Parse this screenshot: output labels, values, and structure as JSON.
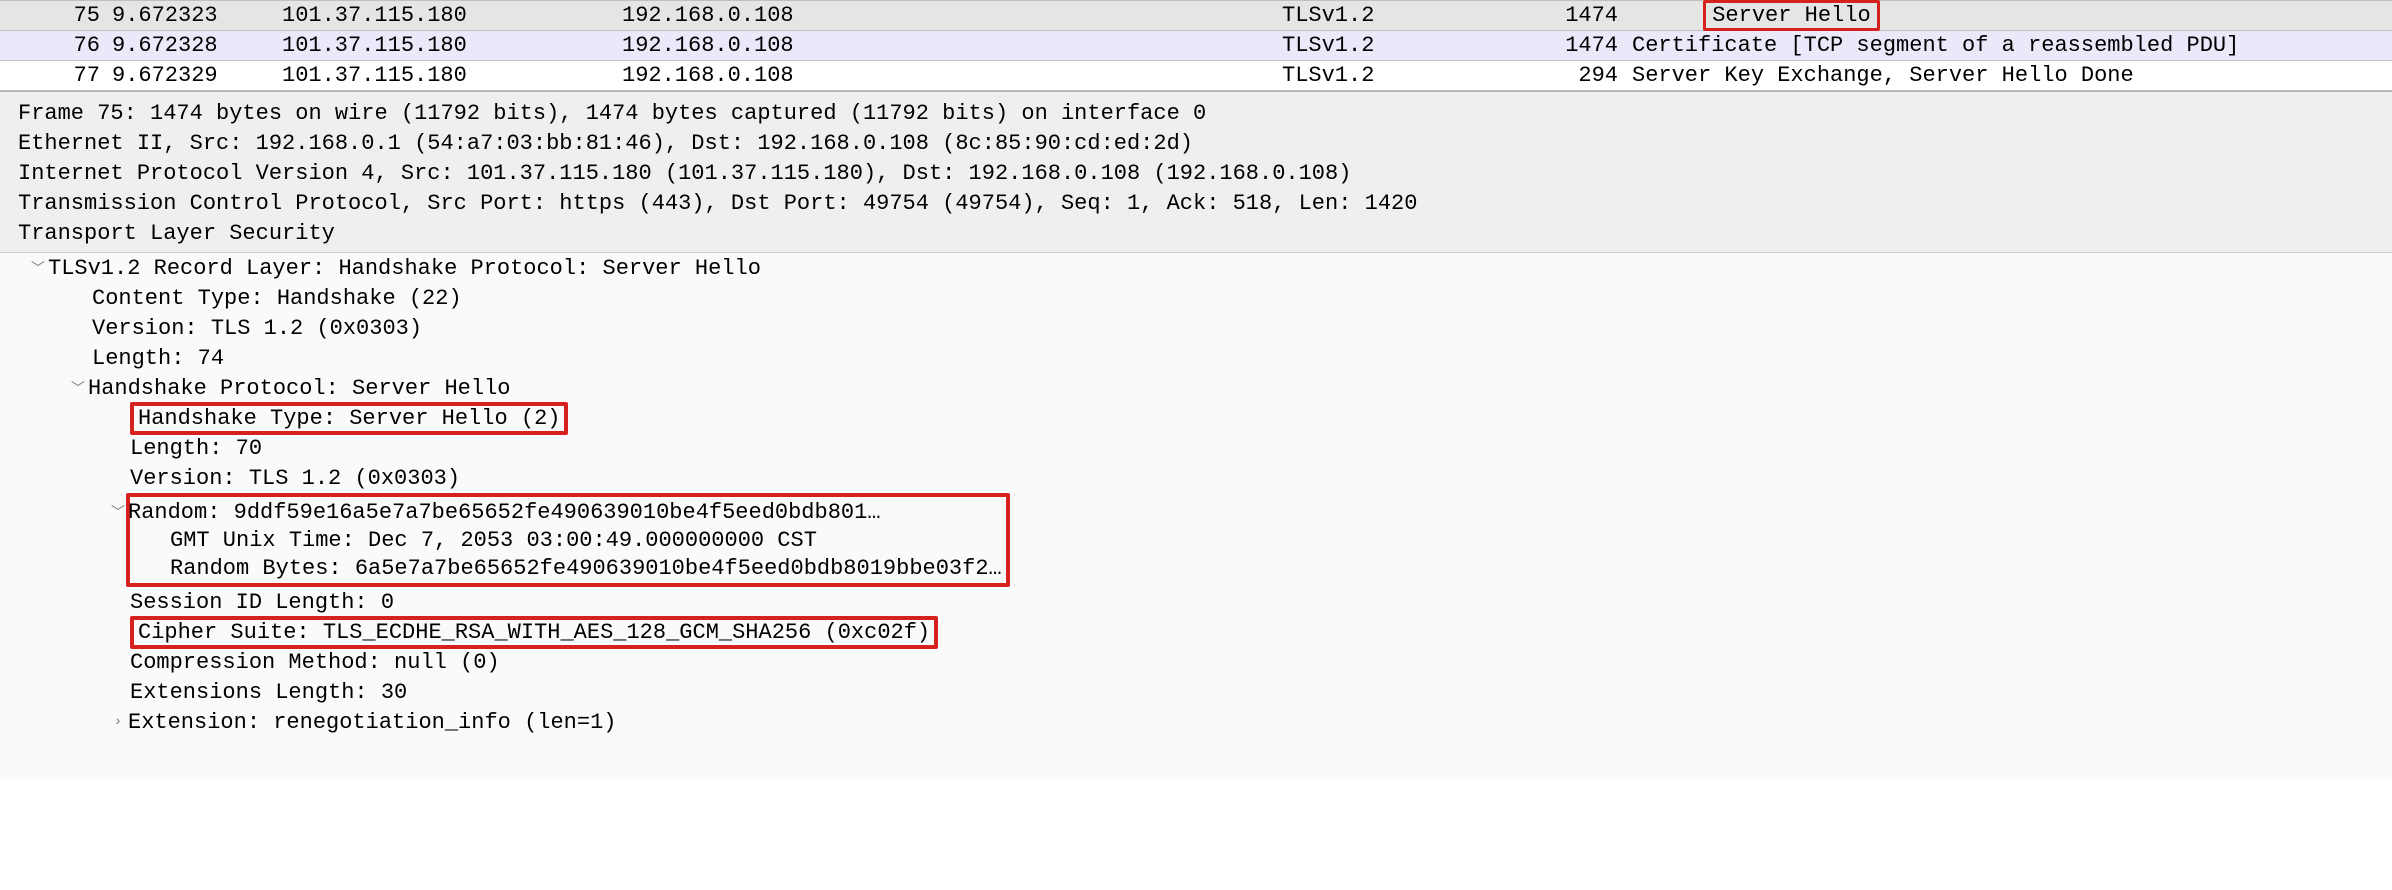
{
  "packets": [
    {
      "no": "75",
      "time": "9.672323",
      "src": "101.37.115.180",
      "dst": "192.168.0.108",
      "proto": "TLSv1.2",
      "len": "1474",
      "info": "Server Hello",
      "highlight_info": true,
      "selected": true
    },
    {
      "no": "76",
      "time": "9.672328",
      "src": "101.37.115.180",
      "dst": "192.168.0.108",
      "proto": "TLSv1.2",
      "len": "1474",
      "info": "Certificate [TCP segment of a reassembled PDU]",
      "alt": true
    },
    {
      "no": "77",
      "time": "9.672329",
      "src": "101.37.115.180",
      "dst": "192.168.0.108",
      "proto": "TLSv1.2",
      "len": "294",
      "info": "Server Key Exchange, Server Hello Done"
    }
  ],
  "summary": {
    "frame": "Frame 75: 1474 bytes on wire (11792 bits), 1474 bytes captured (11792 bits) on interface 0",
    "ethernet": "Ethernet II, Src: 192.168.0.1 (54:a7:03:bb:81:46), Dst: 192.168.0.108 (8c:85:90:cd:ed:2d)",
    "ip": "Internet Protocol Version 4, Src: 101.37.115.180 (101.37.115.180), Dst: 192.168.0.108 (192.168.0.108)",
    "tcp": "Transmission Control Protocol, Src Port: https (443), Dst Port: 49754 (49754), Seq: 1, Ack: 518, Len: 1420",
    "tls": "Transport Layer Security"
  },
  "tlstree": {
    "record": "TLSv1.2 Record Layer: Handshake Protocol: Server Hello",
    "content_type": "Content Type: Handshake (22)",
    "version": "Version: TLS 1.2 (0x0303)",
    "length": "Length: 74",
    "handshake": "Handshake Protocol: Server Hello",
    "hs_type": "Handshake Type: Server Hello (2)",
    "hs_length": "Length: 70",
    "hs_version": "Version: TLS 1.2 (0x0303)",
    "random": "Random: 9ddf59e16a5e7a7be65652fe490639010be4f5eed0bdb801…",
    "gmt": "GMT Unix Time: Dec  7, 2053 03:00:49.000000000 CST",
    "rand_bytes": "Random Bytes: 6a5e7a7be65652fe490639010be4f5eed0bdb8019bbe03f2…",
    "sess_id_len": "Session ID Length: 0",
    "cipher": "Cipher Suite: TLS_ECDHE_RSA_WITH_AES_128_GCM_SHA256 (0xc02f)",
    "compression": "Compression Method: null (0)",
    "ext_len": "Extensions Length: 30",
    "ext_reneg": "Extension: renegotiation_info (len=1)"
  },
  "icons": {
    "down": "﹀",
    "right": "›"
  }
}
